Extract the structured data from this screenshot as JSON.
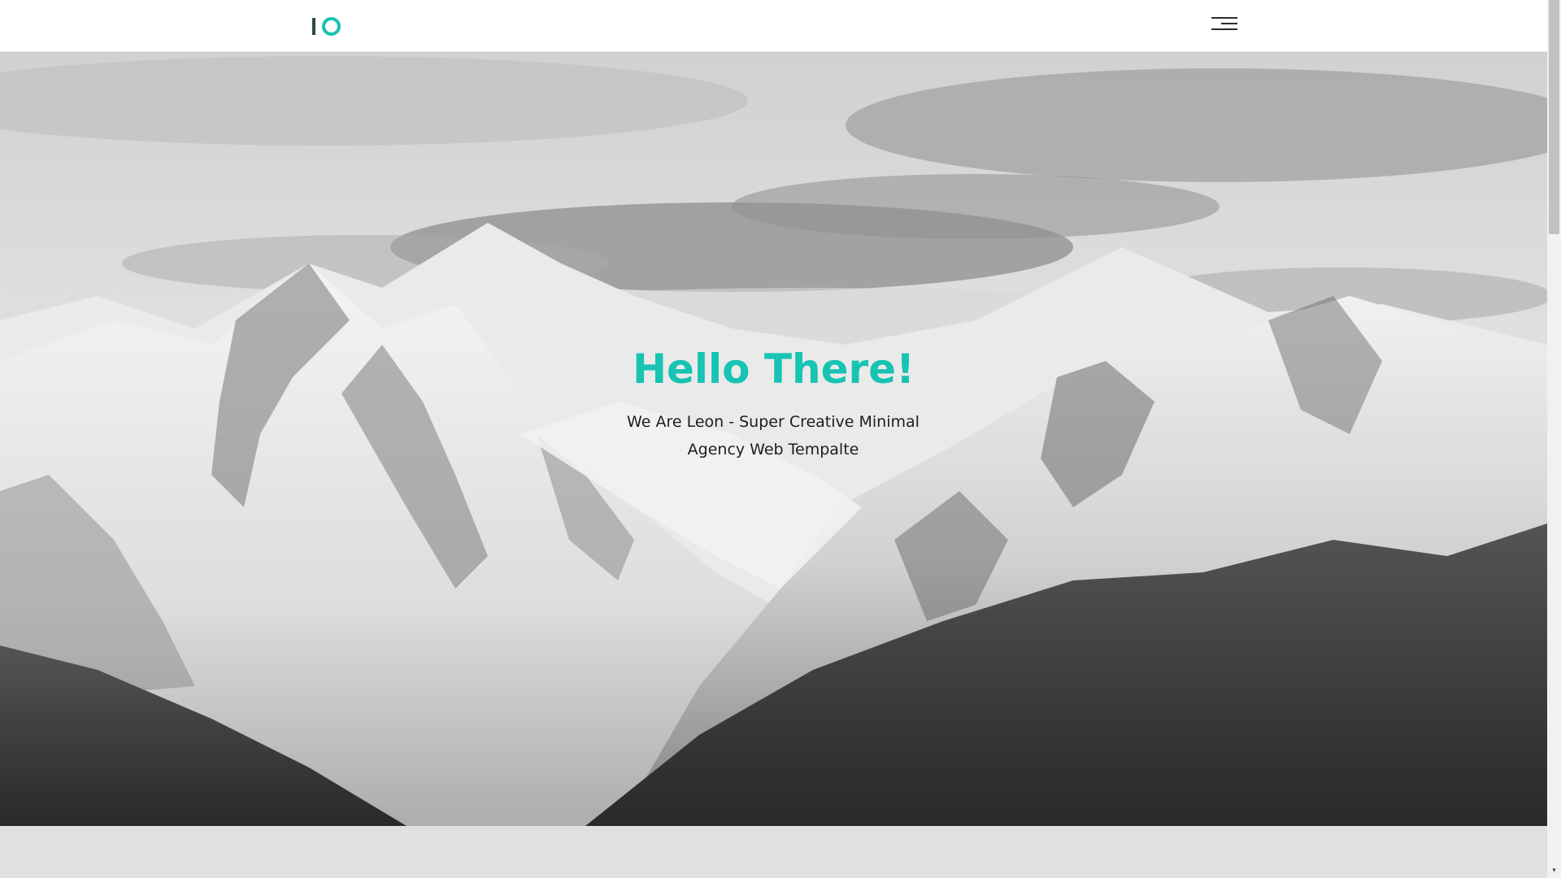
{
  "header": {
    "logo_text": "IO",
    "menu_icon": "hamburger-menu-icon"
  },
  "hero": {
    "title": "Hello There!",
    "subtitle_line1": "We Are Leon - Super Creative Minimal",
    "subtitle_line2": "Agency Web Tempalte",
    "background": "snowy-mountains-photo"
  },
  "colors": {
    "accent": "#17c3b2",
    "logo_dark": "#2d4a4a",
    "text_dark": "#1d1d1d"
  },
  "scrollbar": {
    "down_arrow": "▾"
  }
}
